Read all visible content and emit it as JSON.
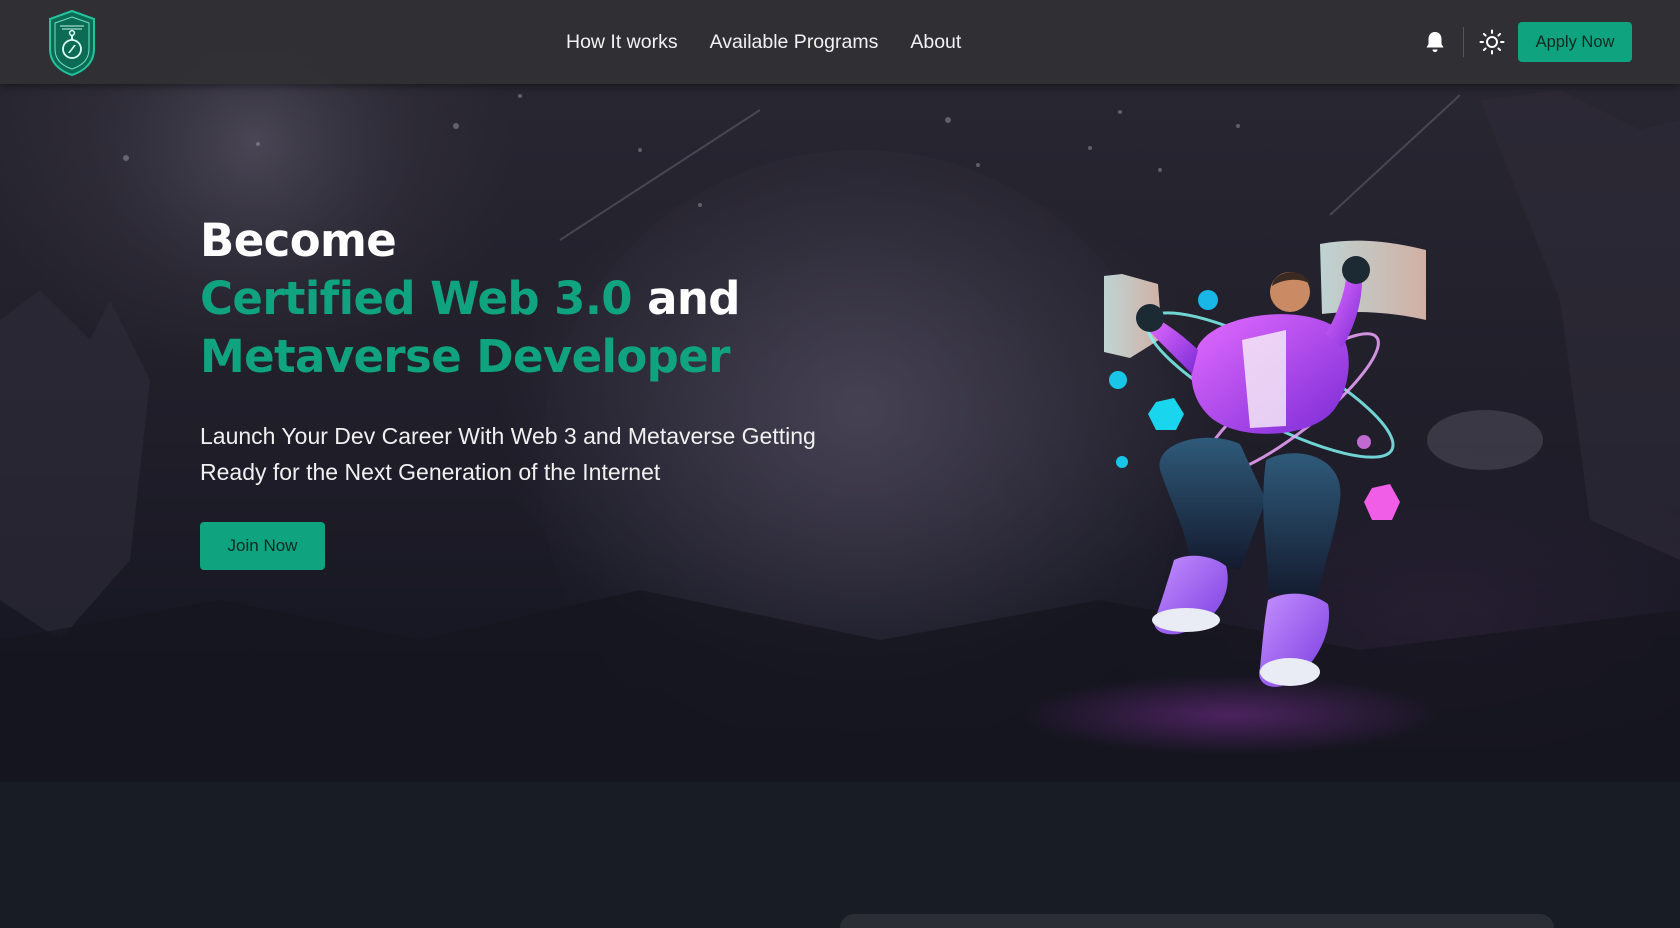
{
  "nav": {
    "logo_icon": "compass-shield-logo",
    "links": [
      "How It works",
      "Available Programs",
      "About"
    ],
    "bell_icon": "bell-icon",
    "theme_icon": "sun-icon",
    "apply_label": "Apply Now"
  },
  "hero": {
    "headline": {
      "line1": "Become",
      "line2_highlight": "Certified Web 3.0",
      "line2_rest": " and",
      "line3_highlight": "Metaverse Developer"
    },
    "subtext_line1": "Launch Your Dev Career With Web 3 and Metaverse Getting",
    "subtext_line2": "Ready for the Next Generation of the Internet",
    "join_label": "Join Now",
    "illustration": "metaverse-developer-figure"
  },
  "colors": {
    "accent": "#10a37f",
    "navbar": "#303034",
    "hero_dark": "#1c1b26",
    "page": "#181d25"
  }
}
